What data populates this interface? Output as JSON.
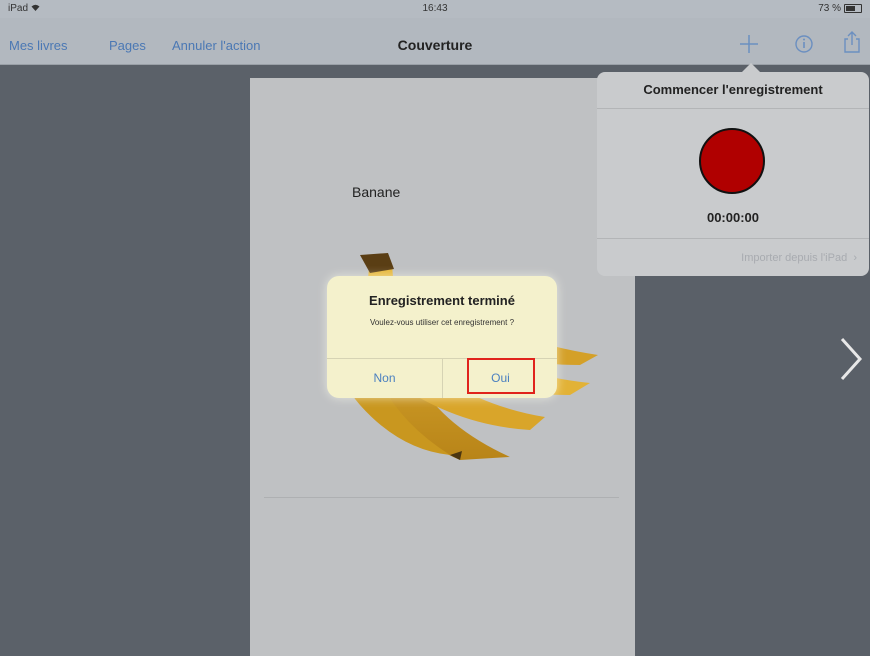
{
  "status_bar": {
    "device": "iPad",
    "wifi_icon": "wifi-icon",
    "time": "16:43",
    "battery_text": "73 %"
  },
  "nav": {
    "my_books": "Mes livres",
    "pages": "Pages",
    "undo": "Annuler l'action",
    "title": "Couverture",
    "icons": [
      "plus-icon",
      "info-icon",
      "share-icon"
    ]
  },
  "page": {
    "caption": "Banane"
  },
  "popover": {
    "title": "Commencer l'enregistrement",
    "timer": "00:00:00",
    "import_label": "Importer depuis l'iPad"
  },
  "alert": {
    "title": "Enregistrement terminé",
    "message": "Voulez-vous utiliser cet enregistrement ?",
    "no_label": "Non",
    "yes_label": "Oui"
  },
  "colors": {
    "accent": "#4b78b4",
    "record": "#b00000",
    "highlight": "#e0231c"
  }
}
